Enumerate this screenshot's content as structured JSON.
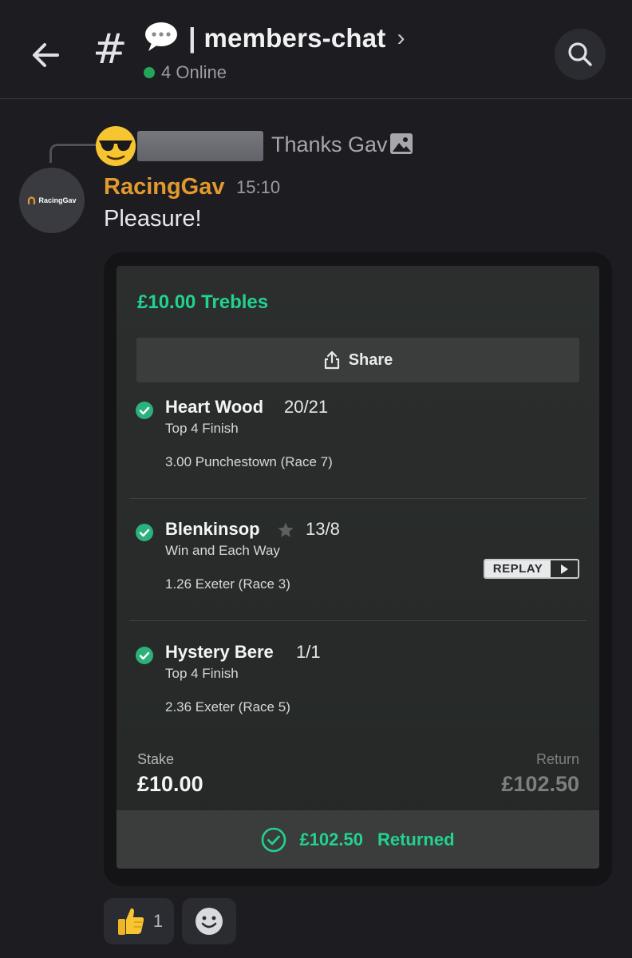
{
  "header": {
    "channel_name": "members-chat",
    "separator": "|",
    "chevron": "›",
    "online_text": "4 Online",
    "online_color": "#23a55a",
    "icons": [
      "back-arrow-icon",
      "hash-icon",
      "speech-bubble-icon",
      "search-icon"
    ]
  },
  "reply": {
    "text": "Thanks Gav",
    "icons": [
      "sunglasses-emoji-icon",
      "image-icon"
    ]
  },
  "message": {
    "author": "RacingGav",
    "author_color": "#e29a2f",
    "timestamp": "15:10",
    "text": "Pleasure!",
    "avatar_label": "RacingGav"
  },
  "bet_slip": {
    "title": "£10.00 Trebles",
    "accent": "#22d28f",
    "share_label": "Share",
    "legs": [
      {
        "name": "Heart Wood",
        "odds": "20/21",
        "market": "Top 4 Finish",
        "race": "3.00 Punchestown (Race 7)",
        "starred": false,
        "replay": false
      },
      {
        "name": "Blenkinsop",
        "odds": "13/8",
        "market": "Win and Each Way",
        "race": "1.26 Exeter (Race 3)",
        "starred": true,
        "replay": true
      },
      {
        "name": "Hystery Bere",
        "odds": "1/1",
        "market": "Top 4 Finish",
        "race": "2.36 Exeter (Race 5)",
        "starred": false,
        "replay": false
      }
    ],
    "replay_label": "REPLAY",
    "stake_label": "Stake",
    "stake_value": "£10.00",
    "return_label": "Return",
    "return_value": "£102.50",
    "returned_amount": "£102.50",
    "returned_label": "Returned"
  },
  "reactions": {
    "thumbs_up_count": "1",
    "icons": [
      "thumbs-up-emoji-icon",
      "add-reaction-icon"
    ]
  }
}
